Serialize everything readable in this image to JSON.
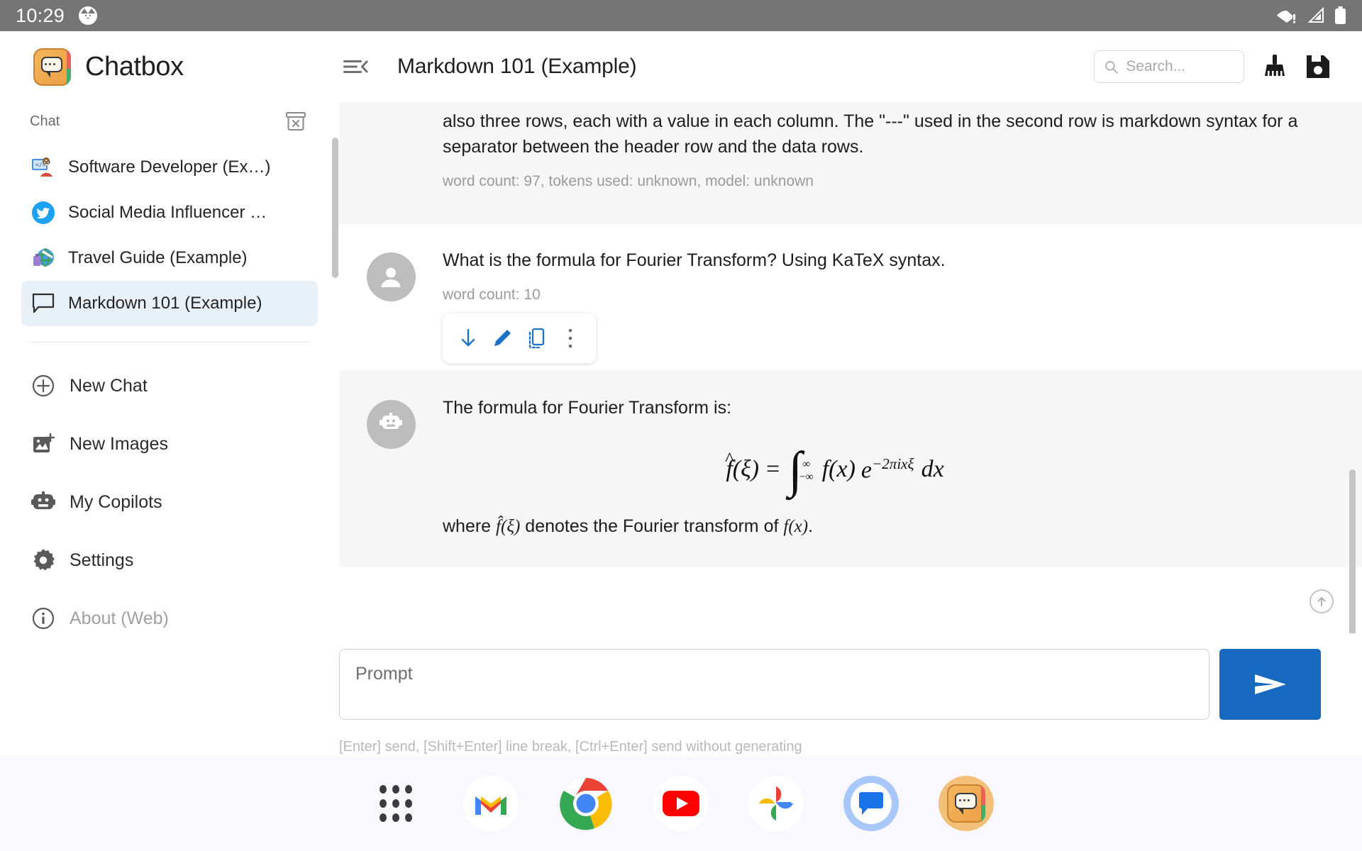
{
  "status_bar": {
    "time": "10:29",
    "left_icon": "cat-avatar-icon",
    "right_icons": [
      "wifi-warning-icon",
      "cellular-signal-icon",
      "battery-full-icon"
    ]
  },
  "header": {
    "brand": "Chatbox",
    "brand_logo_icon": "chatbox-logo-icon",
    "collapse_icon": "menu-collapse-icon",
    "title": "Markdown 101 (Example)",
    "search_placeholder": "Search...",
    "search_value": "",
    "search_icon": "search-icon",
    "clean_icon": "broom-clean-icon",
    "save_icon": "floppy-save-icon"
  },
  "sidebar": {
    "section_label": "Chat",
    "archive_icon": "archive-box-x-icon",
    "chats": [
      {
        "label": "Software Developer (Ex…)",
        "icon": "developer-emoji-icon",
        "selected": false
      },
      {
        "label": "Social Media Influencer …",
        "icon": "twitter-bird-icon",
        "selected": false
      },
      {
        "label": "Travel Guide (Example)",
        "icon": "travel-globe-emoji-icon",
        "selected": false
      },
      {
        "label": "Markdown 101 (Example)",
        "icon": "chat-bubble-icon",
        "selected": true
      }
    ],
    "nav": [
      {
        "label": "New Chat",
        "icon": "plus-circle-icon",
        "muted": false
      },
      {
        "label": "New Images",
        "icon": "image-plus-icon",
        "muted": false
      },
      {
        "label": "My Copilots",
        "icon": "robot-icon",
        "muted": false
      },
      {
        "label": "Settings",
        "icon": "gear-icon",
        "muted": false
      },
      {
        "label": "About (Web)",
        "icon": "info-circle-icon",
        "muted": true
      }
    ]
  },
  "conversation": {
    "messages": [
      {
        "role": "assistant",
        "text": "also three rows, each with a value in each column. The \"---\" used in the second row is markdown syntax for a separator between the header row and the data rows.",
        "meta": "word count: 97, tokens used: unknown, model: unknown",
        "truncated_top": true
      },
      {
        "role": "user",
        "avatar_icon": "person-avatar-icon",
        "text": "What is the formula for Fourier Transform? Using KaTeX syntax.",
        "meta": "word count: 10"
      },
      {
        "role": "assistant",
        "avatar_icon": "robot-avatar-icon",
        "text_before": "The formula for Fourier Transform is:",
        "formula_latex": "\\hat f(\\xi) = \\int_{-\\infty}^{\\infty} f(x)\\,e^{-2\\pi i x \\xi}\\,dx",
        "text_after_1": "where ",
        "text_after_inline_1": "f̂(ξ)",
        "text_after_2": " denotes the Fourier transform of ",
        "text_after_inline_2": "f(x)",
        "text_after_3": "."
      }
    ],
    "message_actions": [
      {
        "name": "download-icon",
        "glyph": "arrow-down"
      },
      {
        "name": "edit-pencil-icon",
        "glyph": "pencil"
      },
      {
        "name": "copy-icon",
        "glyph": "copy"
      },
      {
        "name": "more-options-icon",
        "glyph": "kebab"
      }
    ],
    "scroll_up_icon": "scroll-to-top-icon",
    "scroll_down_icon": "scroll-to-bottom-icon"
  },
  "composer": {
    "placeholder": "Prompt",
    "value": "",
    "send_icon": "send-paper-plane-icon",
    "hint": "[Enter] send, [Shift+Enter] line break, [Ctrl+Enter] send without generating"
  },
  "dock": {
    "items": [
      {
        "name": "app-drawer-icon",
        "label": "App drawer"
      },
      {
        "name": "gmail-icon",
        "label": "Gmail"
      },
      {
        "name": "chrome-icon",
        "label": "Chrome"
      },
      {
        "name": "youtube-icon",
        "label": "YouTube"
      },
      {
        "name": "google-photos-icon",
        "label": "Photos"
      },
      {
        "name": "google-messages-icon",
        "label": "Messages"
      },
      {
        "name": "chatbox-app-icon",
        "label": "Chatbox"
      }
    ]
  },
  "colors": {
    "accent_blue": "#1769c0",
    "status_bar_bg": "#757575",
    "assistant_msg_bg": "#f6f6f6",
    "selected_chat_bg": "#e9f1f8",
    "dock_bg": "#faf8ff"
  }
}
